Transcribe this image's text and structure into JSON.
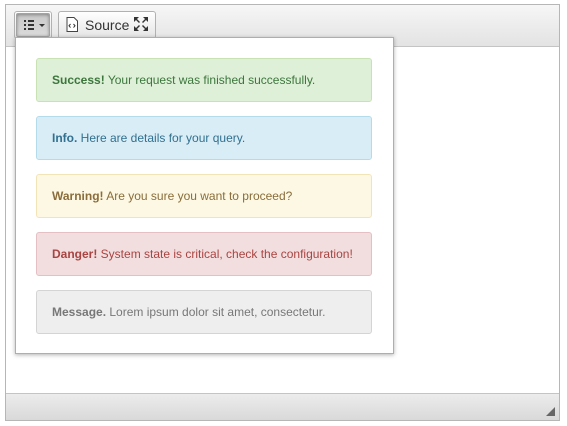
{
  "toolbar": {
    "alerts_button": {
      "icon": "alerts-icon",
      "dropdown_arrow": "chevron-down-icon"
    },
    "source_button": {
      "label": "Source",
      "icon": "source-code-icon"
    },
    "maximize_button": {
      "icon": "maximize-icon"
    }
  },
  "alerts_menu": {
    "items": [
      {
        "title": "Success!",
        "text": " Your request was finished successfully.",
        "background": "#dff0d8",
        "color": "#3c763d"
      },
      {
        "title": "Info.",
        "text": " Here are details for your query.",
        "background": "#d9edf7",
        "color": "#31708f"
      },
      {
        "title": "Warning!",
        "text": " Are you sure you want to proceed?",
        "background": "#fcf8e3",
        "color": "#8a6d3b"
      },
      {
        "title": "Danger!",
        "text": " System state is critical, check the configuration!",
        "background": "#f2dede",
        "color": "#a94442"
      },
      {
        "title": "Message.",
        "text": " Lorem ipsum dolor sit amet, consectetur.",
        "background": "#eeeeee",
        "color": "#777777"
      }
    ]
  },
  "statusbar": {
    "resize_icon": "resize-grip-icon"
  }
}
